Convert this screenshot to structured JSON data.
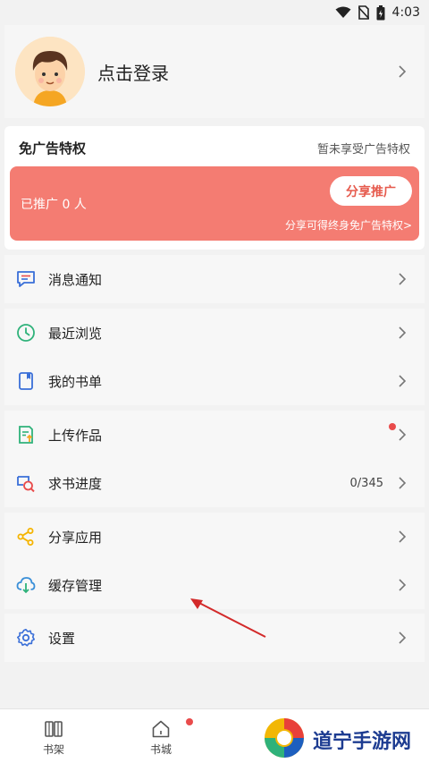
{
  "status_bar": {
    "time": "4:03",
    "icons": [
      "wifi-icon",
      "no-sim-icon",
      "battery-icon"
    ]
  },
  "profile": {
    "login_text": "点击登录",
    "avatar": "cartoon-boy-avatar"
  },
  "ad_privilege": {
    "title": "免广告特权",
    "status": "暂未享受广告特权",
    "promoted_count": "已推广 0 人",
    "share_button": "分享推广",
    "share_link": "分享可得终身免广告特权>"
  },
  "menu": {
    "notifications": {
      "label": "消息通知",
      "icon": "message-icon"
    },
    "recent": {
      "label": "最近浏览",
      "icon": "clock-icon"
    },
    "booklist": {
      "label": "我的书单",
      "icon": "bookmark-icon"
    },
    "upload": {
      "label": "上传作品",
      "icon": "upload-doc-icon"
    },
    "request": {
      "label": "求书进度",
      "icon": "search-book-icon",
      "value": "0/345"
    },
    "share_app": {
      "label": "分享应用",
      "icon": "share-icon"
    },
    "cache": {
      "label": "缓存管理",
      "icon": "cloud-download-icon"
    },
    "settings": {
      "label": "设置",
      "icon": "gear-icon"
    }
  },
  "tabs": {
    "bookshelf": "书架",
    "bookstore": "书城"
  },
  "watermark": {
    "text": "道宁手游网"
  },
  "colors": {
    "promo_bg": "#f47c72",
    "share_btn_text": "#e65a4d",
    "badge": "#e94b4b",
    "arrow": "#d32a2a"
  }
}
